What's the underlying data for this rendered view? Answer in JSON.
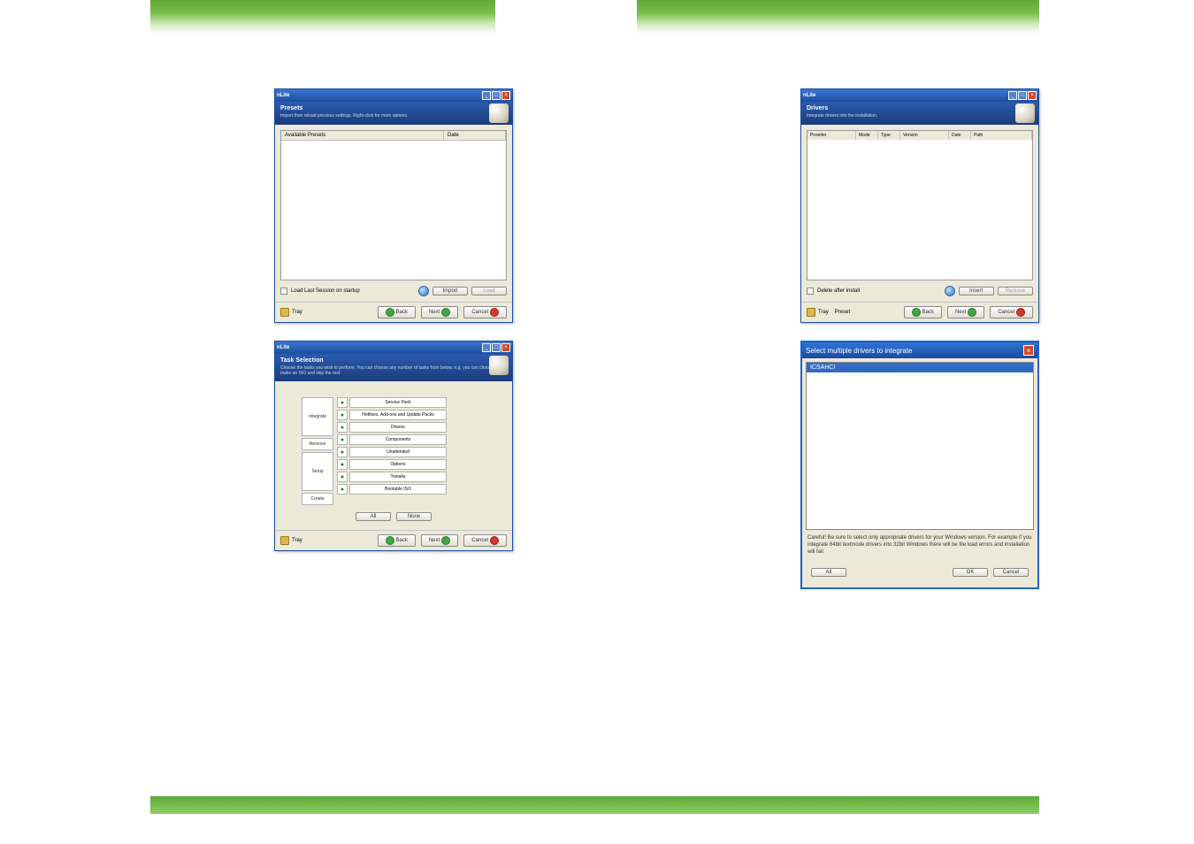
{
  "app_name": "nLite",
  "windows": {
    "presets": {
      "title": "nLite",
      "header": "Presets",
      "subheader": "Import then reload previous settings. Right-click for more options.",
      "columns": {
        "c1": "Available Presets",
        "c2": "Date"
      },
      "checkbox_label": "Load Last Session on startup",
      "buttons": {
        "import": "Import",
        "load": "Load"
      }
    },
    "tasks": {
      "title": "nLite",
      "header": "Task Selection",
      "subheader": "Choose the tasks you wish to perform. You can choose any number of tasks from below, e.g. you can choose to make an ISO and skip the rest.",
      "groups": {
        "integrate": "Integrate",
        "remove": "Remove",
        "setup": "Setup",
        "create": "Create"
      },
      "items": {
        "service_pack": "Service Pack",
        "hotfixes": "Hotfixes, Add-ons and Update Packs",
        "drivers": "Drivers",
        "components": "Components",
        "unattended": "Unattended",
        "options": "Options",
        "tweaks": "Tweaks",
        "bootable_iso": "Bootable ISO"
      },
      "buttons": {
        "all": "All",
        "none": "None"
      }
    },
    "drivers": {
      "title": "nLite",
      "header": "Drivers",
      "subheader": "Integrate drivers into the installation.",
      "columns": {
        "provider": "Provider",
        "mode": "Mode",
        "type": "Type",
        "version": "Version",
        "date": "Date",
        "path": "Path"
      },
      "checkbox_label": "Delete after install",
      "buttons": {
        "insert": "Insert",
        "remove": "Remove"
      },
      "preset_label": "Preset"
    },
    "select": {
      "title": "Select multiple drivers to integrate",
      "folder": "ICSAHCI",
      "warning": "Careful! Be sure to select only appropriate drivers for your Windows version. For example if you integrate 64bit textmode drivers into 32bit Windows there will be file load errors and installation will fail.",
      "buttons": {
        "all": "All",
        "ok": "OK",
        "cancel": "Cancel"
      }
    }
  },
  "nav": {
    "back": "Back",
    "next": "Next",
    "cancel": "Cancel",
    "tray": "Tray"
  }
}
